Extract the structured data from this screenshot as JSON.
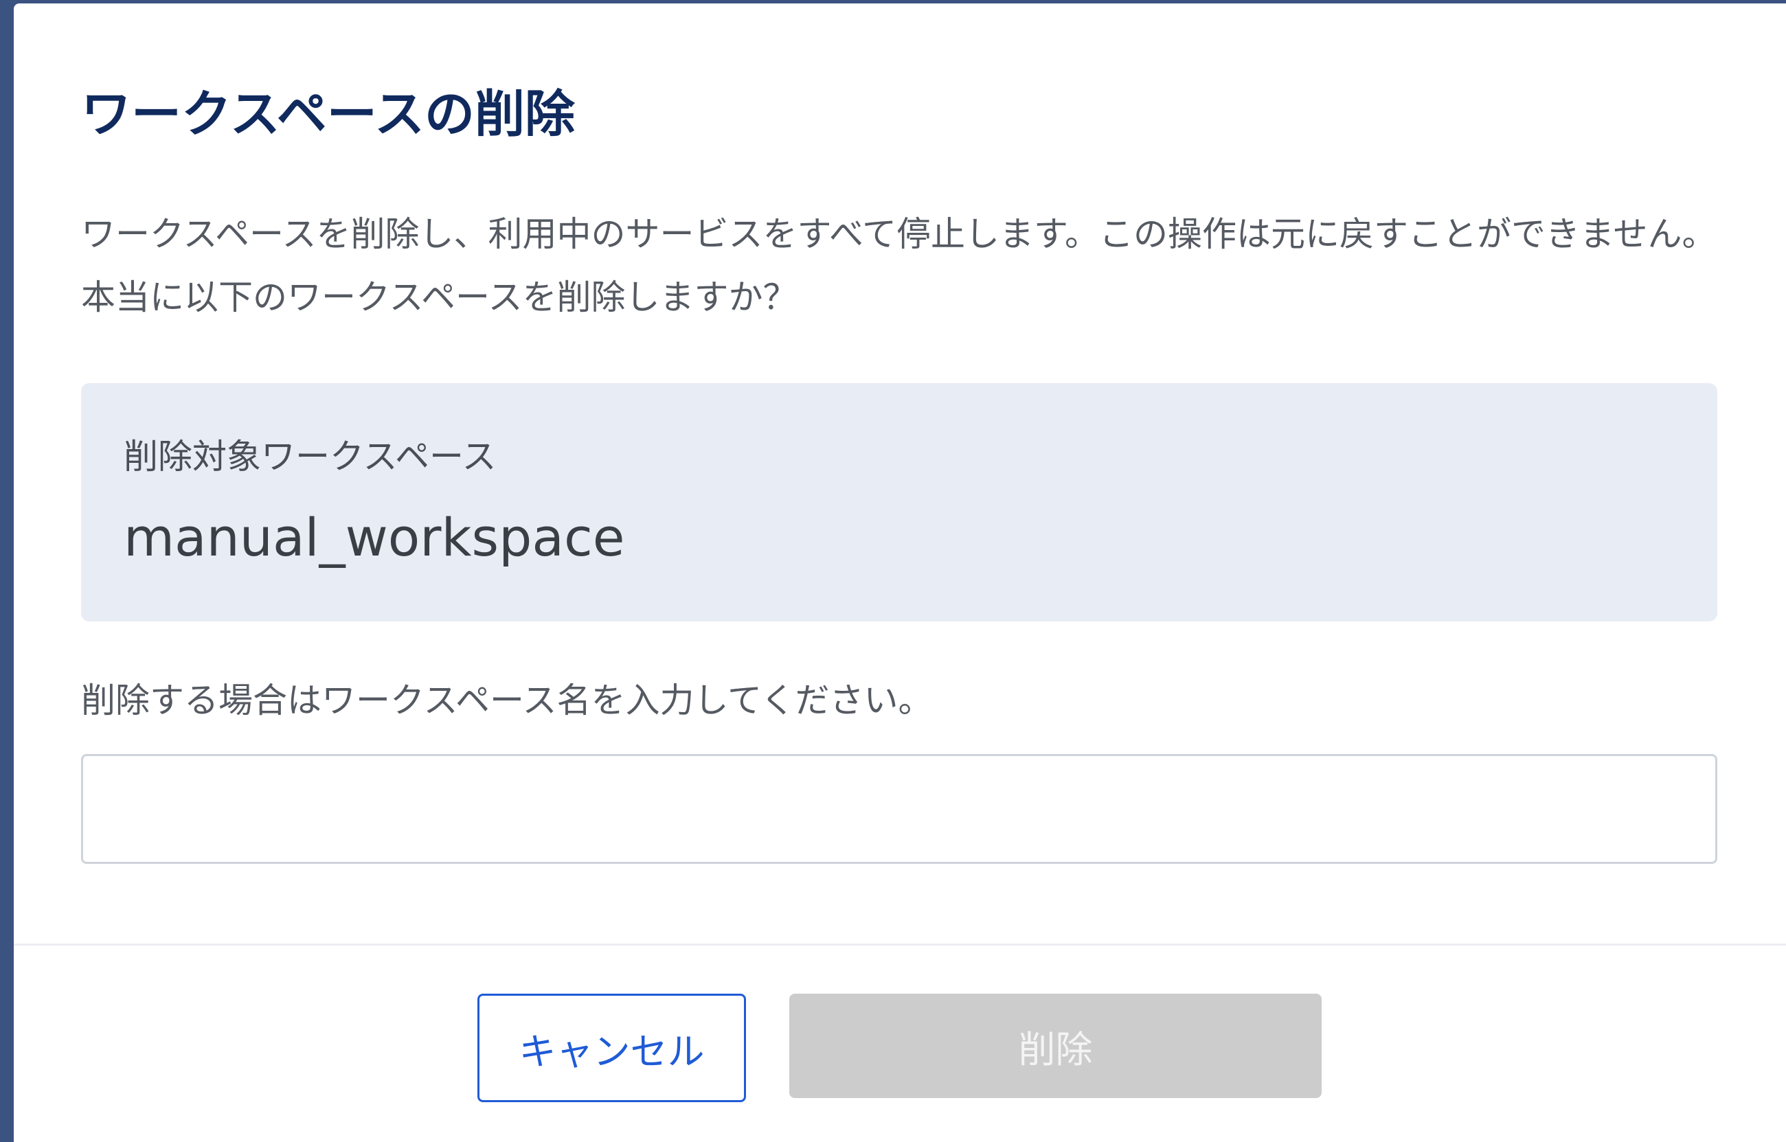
{
  "modal": {
    "title": "ワークスペースの削除",
    "description": "ワークスペースを削除し、利用中のサービスをすべて停止します。この操作は元に戻すことができません。本当に以下のワークスペースを削除しますか？",
    "target": {
      "label": "削除対象ワークスペース",
      "name": "manual_workspace"
    },
    "confirm": {
      "label": "削除する場合はワークスペース名を入力してください。",
      "value": ""
    },
    "buttons": {
      "cancel_label": "キャンセル",
      "delete_label": "削除",
      "delete_disabled": true
    }
  },
  "colors": {
    "title": "#102a5e",
    "accent": "#1f5bd6",
    "target_background": "#e8ecf4",
    "disabled_button": "#cccccc",
    "backdrop": "#3b5380"
  }
}
